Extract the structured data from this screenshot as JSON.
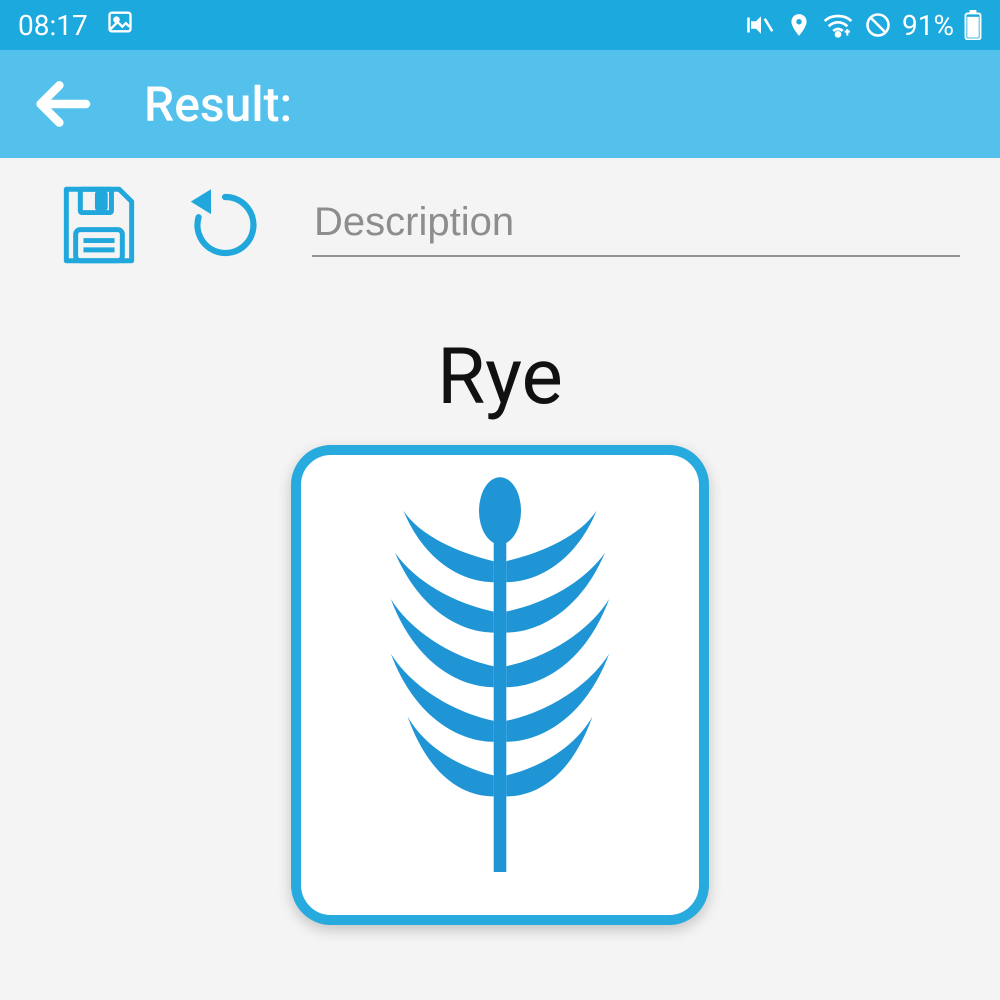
{
  "status": {
    "time": "08:17",
    "battery": "91%"
  },
  "header": {
    "title": "Result:"
  },
  "toolbar": {
    "description_placeholder": "Description"
  },
  "result": {
    "name": "Rye",
    "icon": "wheat-icon"
  },
  "colors": {
    "primary": "#27aade",
    "statusbar": "#1ca9dd",
    "appbar": "#53c1ec"
  }
}
